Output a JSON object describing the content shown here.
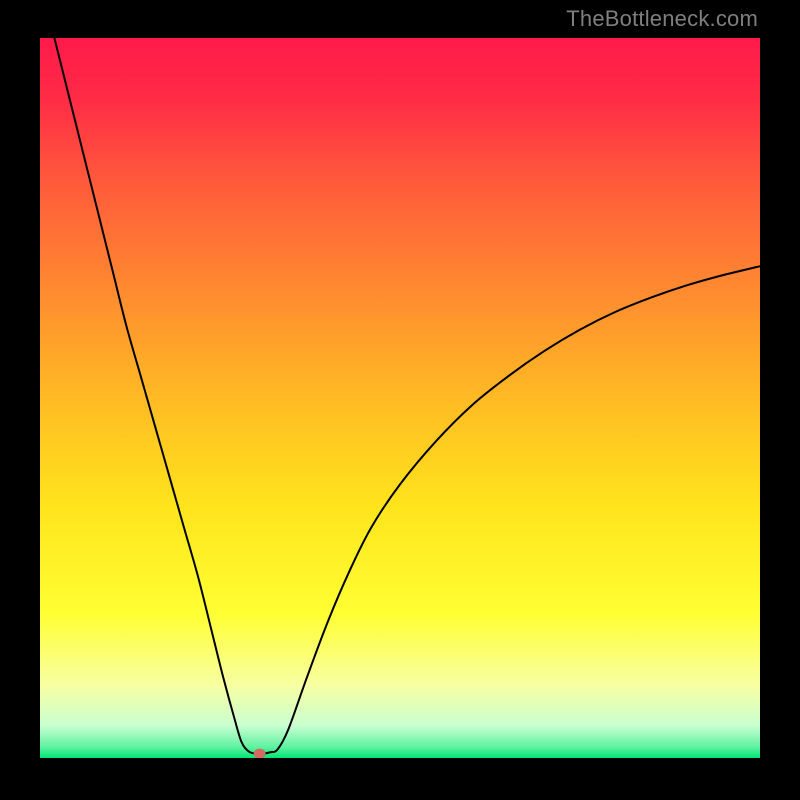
{
  "watermark": "TheBottleneck.com",
  "chart_data": {
    "type": "line",
    "title": "",
    "xlabel": "",
    "ylabel": "",
    "xlim": [
      0,
      100
    ],
    "ylim": [
      0,
      100
    ],
    "grid": false,
    "background": {
      "type": "vertical-gradient",
      "stops": [
        {
          "pos": 0.0,
          "color": "#ff1a4a"
        },
        {
          "pos": 0.08,
          "color": "#ff2a46"
        },
        {
          "pos": 0.2,
          "color": "#ff5a3b"
        },
        {
          "pos": 0.35,
          "color": "#ff8a30"
        },
        {
          "pos": 0.5,
          "color": "#ffba24"
        },
        {
          "pos": 0.65,
          "color": "#ffe41c"
        },
        {
          "pos": 0.8,
          "color": "#ffff33"
        },
        {
          "pos": 0.9,
          "color": "#f7ffa3"
        },
        {
          "pos": 0.955,
          "color": "#c9ffd1"
        },
        {
          "pos": 0.985,
          "color": "#5ef2a0"
        },
        {
          "pos": 1.0,
          "color": "#00e676"
        }
      ]
    },
    "series": [
      {
        "name": "bottleneck-curve",
        "color": "#000000",
        "width": 2,
        "x": [
          2,
          4,
          6,
          8,
          10,
          12,
          14,
          16,
          18,
          20,
          22,
          24,
          25.5,
          27,
          28,
          29,
          30,
          31,
          32,
          33,
          34.5,
          37,
          40,
          43,
          46,
          50,
          55,
          60,
          65,
          70,
          75,
          80,
          85,
          90,
          95,
          100
        ],
        "y": [
          100,
          92,
          84,
          76,
          68,
          60,
          53,
          46,
          39,
          32,
          25,
          17,
          11,
          5.5,
          2.2,
          0.9,
          0.6,
          0.6,
          0.8,
          1.2,
          4,
          11,
          19,
          26,
          32,
          38,
          44,
          49,
          53,
          56.5,
          59.5,
          62,
          64,
          65.7,
          67.1,
          68.3
        ]
      }
    ],
    "marker": {
      "name": "optimal-point",
      "x": 30.5,
      "y": 0.6,
      "color": "#d46a5e",
      "rx": 6,
      "ry": 5
    }
  }
}
